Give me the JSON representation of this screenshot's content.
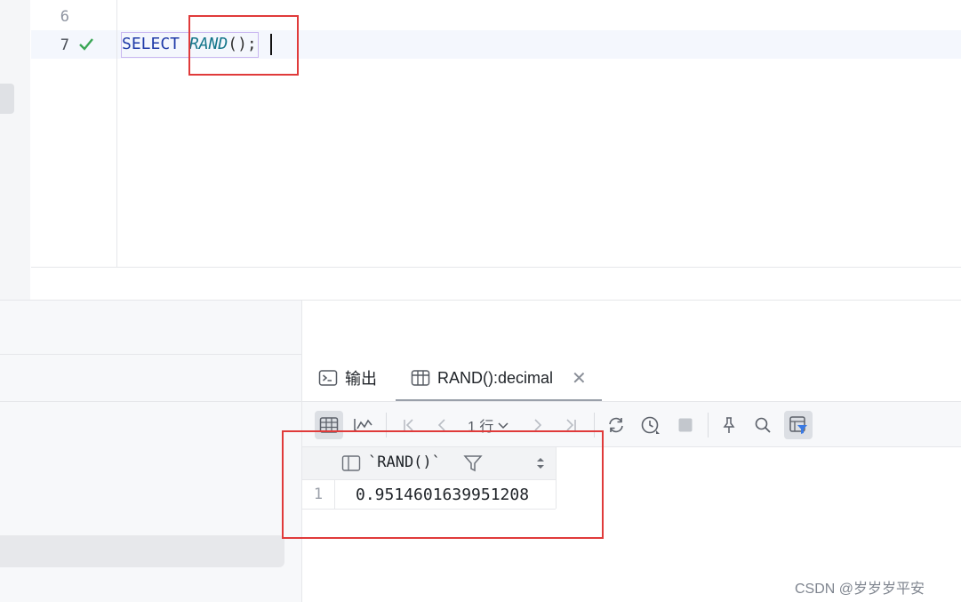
{
  "editor": {
    "line_numbers": [
      "6",
      "7"
    ],
    "code": {
      "keyword": "SELECT",
      "function": "RAND",
      "parens": "()",
      "terminator": ";"
    }
  },
  "result_panel": {
    "tabs": [
      {
        "label": "输出",
        "icon": "terminal-icon"
      },
      {
        "label": "RAND():decimal",
        "icon": "table-icon",
        "active": true
      }
    ],
    "toolbar": {
      "row_count_label": "1 行"
    },
    "grid": {
      "columns": [
        "`RAND()`"
      ],
      "rows": [
        {
          "row_number": "1",
          "values": [
            "0.9514601639951208"
          ]
        }
      ]
    }
  },
  "watermark": "CSDN @岁岁岁平安",
  "colors": {
    "highlight_box": "#e03a3a",
    "keyword": "#1f3aa8",
    "function": "#13758a",
    "success_check": "#3aa655",
    "active_filter": "#3b7ae3"
  }
}
